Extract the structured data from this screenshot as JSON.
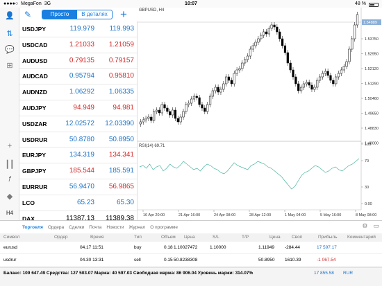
{
  "status_bar": {
    "carrier": "MegaFon",
    "network": "3G",
    "time": "10:07",
    "battery": "48 %"
  },
  "header": {
    "tab_simple": "Просто",
    "tab_detailed": "В деталях"
  },
  "toolbar": {
    "h4_label": "H4"
  },
  "quotes": [
    {
      "symbol": "USDJPY",
      "bid": "119.979",
      "ask": "119.993",
      "dir": "up"
    },
    {
      "symbol": "USDCAD",
      "bid": "1.21033",
      "ask": "1.21059",
      "dir": "dn"
    },
    {
      "symbol": "AUDUSD",
      "bid": "0.79135",
      "ask": "0.79157",
      "dir": "dn"
    },
    {
      "symbol": "AUDCAD",
      "bid": "0.95794",
      "ask": "0.95810",
      "dir": "mixed"
    },
    {
      "symbol": "AUDNZD",
      "bid": "1.06292",
      "ask": "1.06335",
      "dir": "up"
    },
    {
      "symbol": "AUDJPY",
      "bid": "94.949",
      "ask": "94.981",
      "dir": "dn"
    },
    {
      "symbol": "USDZAR",
      "bid": "12.02572",
      "ask": "12.03390",
      "dir": "up"
    },
    {
      "symbol": "USDRUR",
      "bid": "50.8780",
      "ask": "50.8950",
      "dir": "up"
    },
    {
      "symbol": "EURJPY",
      "bid": "134.319",
      "ask": "134.341",
      "dir": "mixed2"
    },
    {
      "symbol": "GBPJPY",
      "bid": "185.544",
      "ask": "185.591",
      "dir": "mixed3"
    },
    {
      "symbol": "EURRUR",
      "bid": "56.9470",
      "ask": "56.9865",
      "dir": "mixed2"
    },
    {
      "symbol": "LCO",
      "bid": "65.23",
      "ask": "65.30",
      "dir": "up"
    },
    {
      "symbol": "DAX",
      "bid": "11387.13",
      "ask": "11389.38",
      "dir": "none"
    }
  ],
  "chart": {
    "symbol_label": "GBPUSD, H4",
    "rsi_label": "RSI(14) 69.71",
    "current_price": "1.54889",
    "price_ticks": [
      "1.53750",
      "1.52950",
      "1.52120",
      "1.51290",
      "1.50460",
      "1.49650",
      "1.48830",
      "1.48000"
    ],
    "rsi_ticks": [
      "100",
      "70",
      "30",
      "0.00"
    ],
    "time_ticks": [
      "16 Apr 20:00",
      "21 Apr 16:00",
      "24 Apr 08:00",
      "28 Apr 12:00",
      "1 May 04:00",
      "5 May 16:00",
      "8 May 08:00"
    ]
  },
  "bottom_tabs": [
    "Торговля",
    "Ордера",
    "Сделки",
    "Почта",
    "Новости",
    "Журнал",
    "О программе"
  ],
  "table": {
    "headers": [
      "Символ",
      "Ордер",
      "Время",
      "Тип",
      "Объем",
      "Цена",
      "S/L",
      "T/P",
      "Цена",
      "Своп",
      "Прибыль",
      "Комментарий"
    ],
    "rows": [
      {
        "symbol": "eurusd",
        "time": "04.17 11:51",
        "type": "buy",
        "volume": "0.18",
        "price": "1.10027472",
        "sl": "1.10000",
        "cur_price": "1.11949",
        "swap": "-284.44",
        "profit": "17 597.17"
      },
      {
        "symbol": "usdrur",
        "time": "04.30 13:31",
        "type": "sell",
        "volume": "0.15",
        "price": "50.8238308",
        "sl": "",
        "cur_price": "50.8950",
        "swap": "1610.39",
        "profit": "-1 067.54"
      }
    ]
  },
  "footer": {
    "summary": "Баланс: 109 647.49 Средства: 127 503.07 Маржа: 40 597.03 Свободная маржа: 86 906.04 Уровень маржи: 314.07%",
    "profit_total": "17 855.58",
    "currency": "RUR"
  },
  "colors": {
    "accent": "#1a7fe0",
    "up": "#1c73c7",
    "down": "#d12828"
  }
}
